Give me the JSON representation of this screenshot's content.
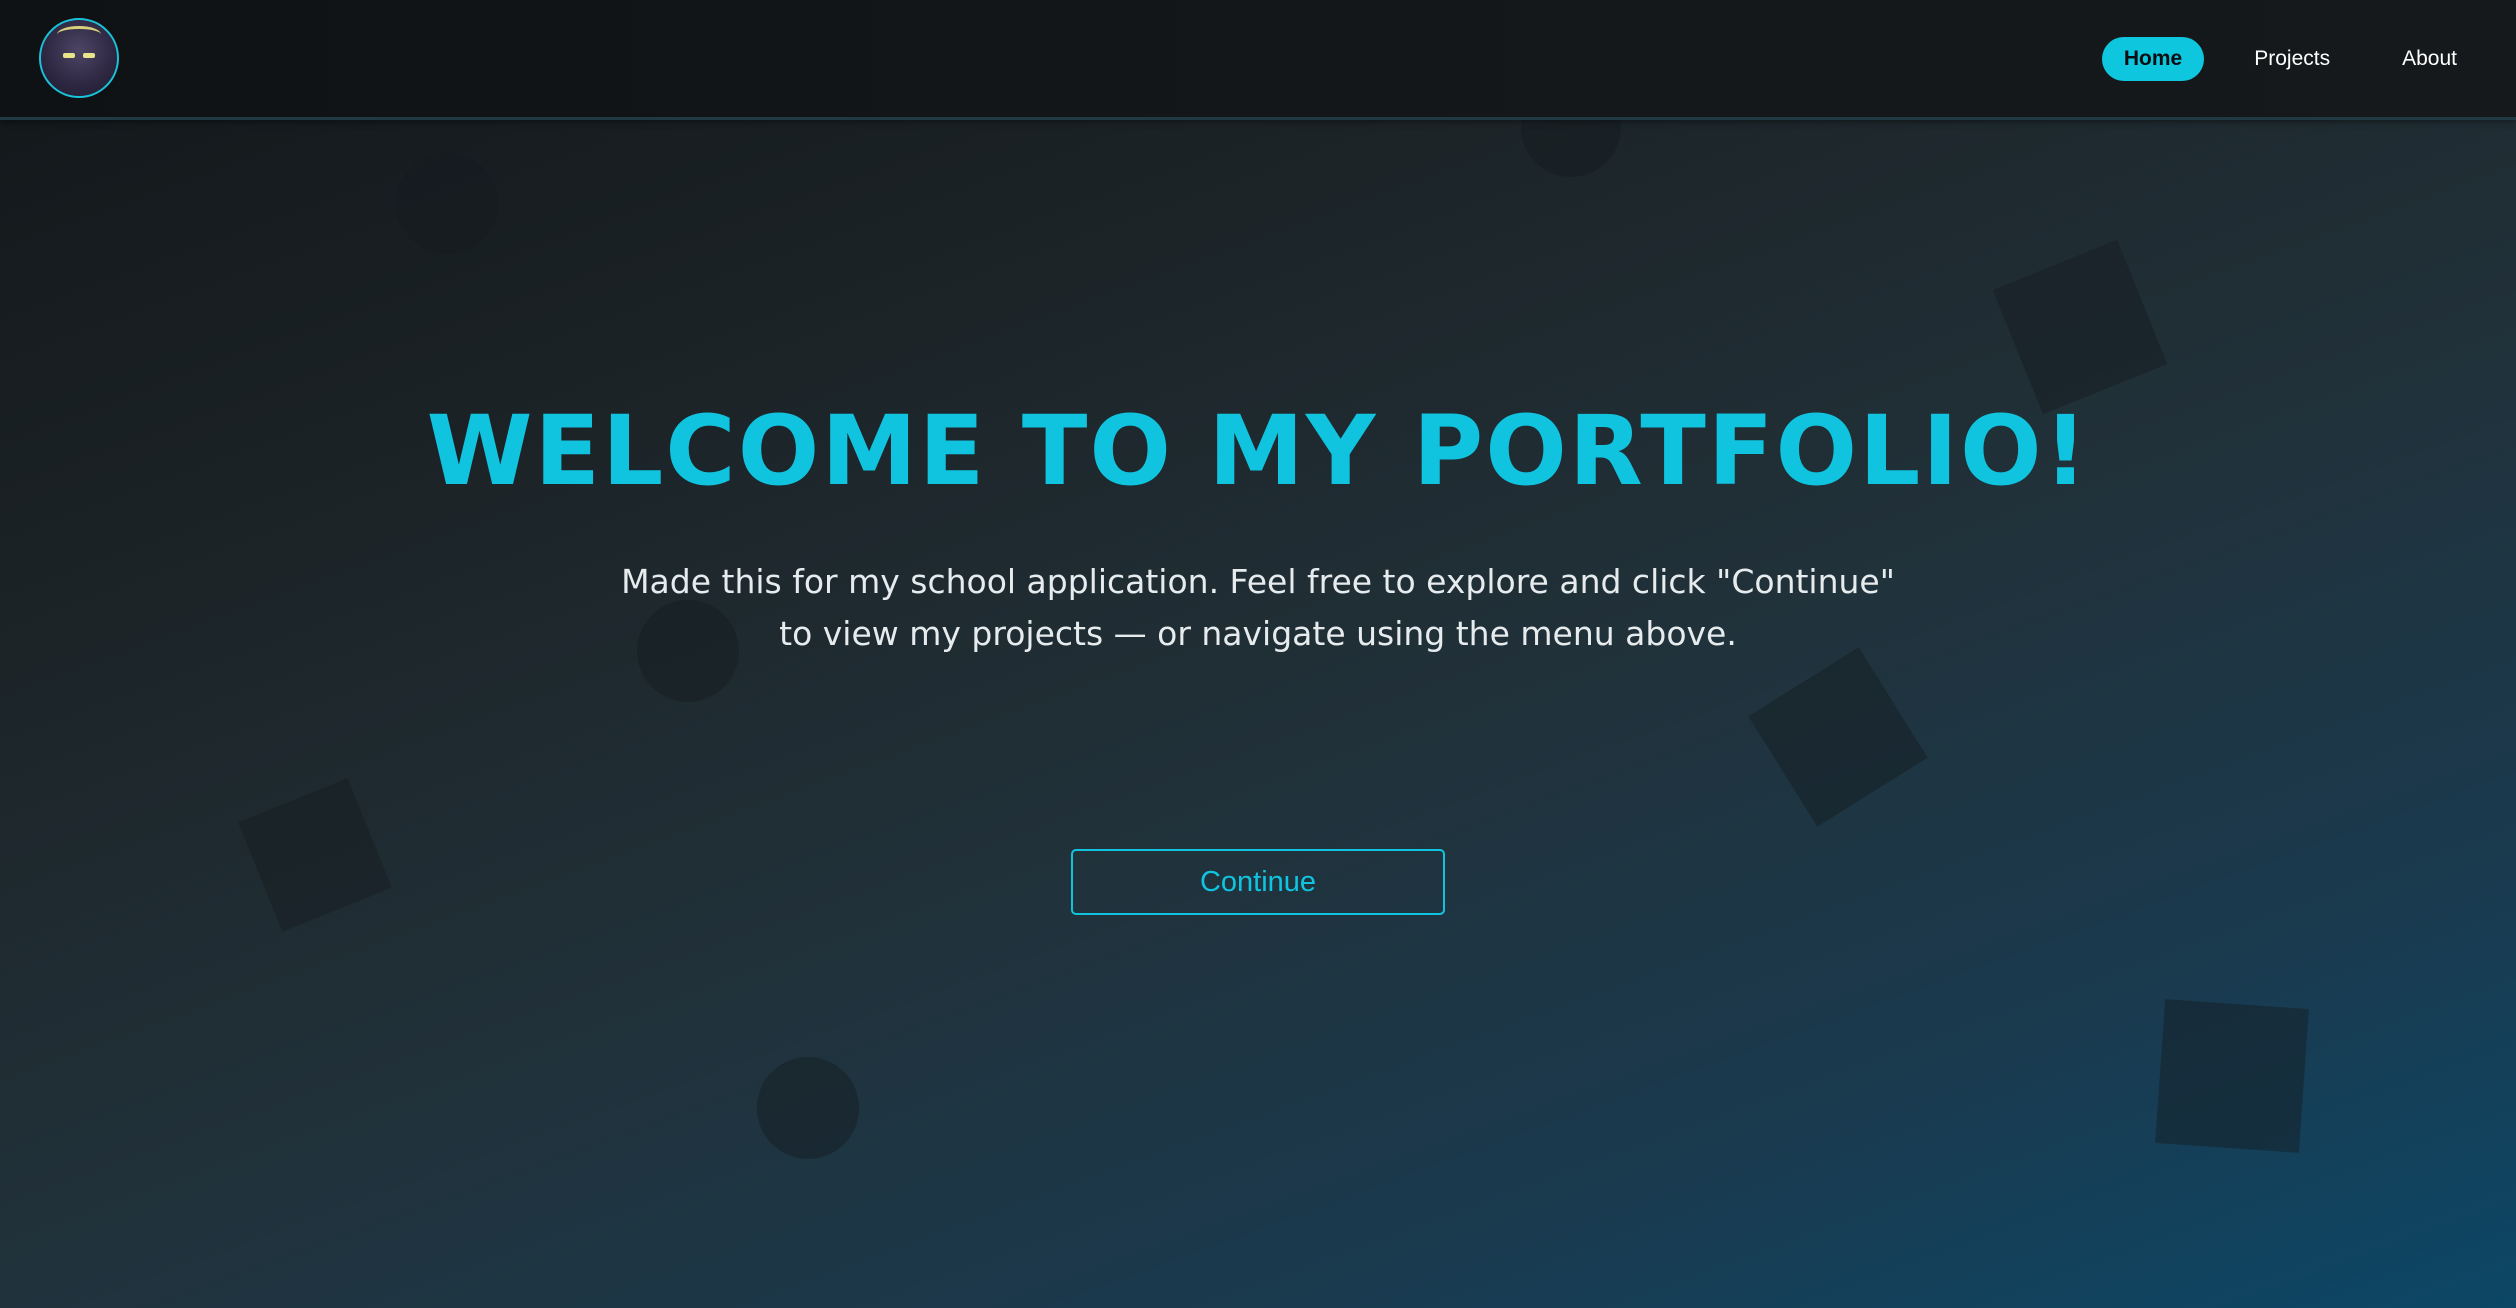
{
  "nav": {
    "logo_alt": "site logo",
    "links": [
      {
        "label": "Home",
        "active": true
      },
      {
        "label": "Projects",
        "active": false
      },
      {
        "label": "About",
        "active": false
      }
    ]
  },
  "hero": {
    "title": "WELCOME TO MY PORTFOLIO!",
    "subtitle": "Made this for my school application. Feel free to explore and click \"Continue\" to view my projects — or navigate using the menu above.",
    "button_label": "Continue"
  },
  "colors": {
    "accent": "#10c4df",
    "background_dark": "#121619",
    "background_blue": "#0c4766",
    "text_light": "#e6ebee"
  }
}
